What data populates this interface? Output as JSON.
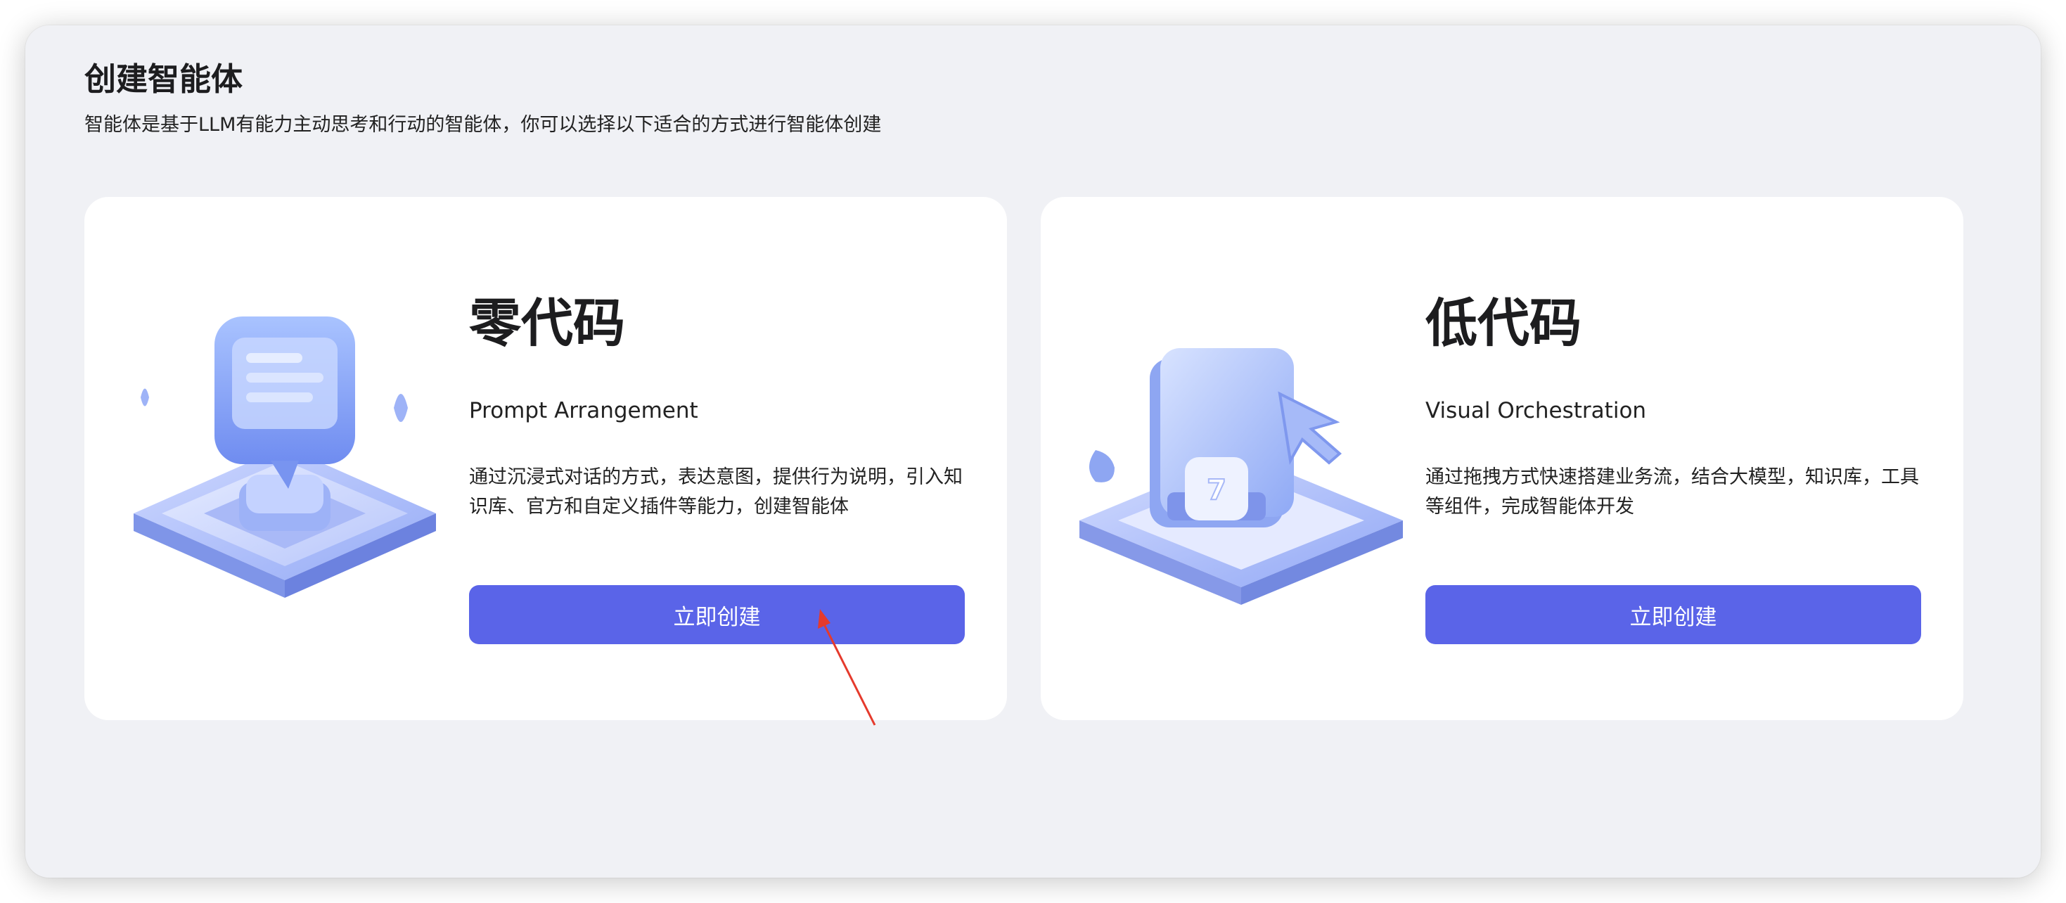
{
  "header": {
    "title": "创建智能体",
    "subtitle": "智能体是基于LLM有能力主动思考和行动的智能体，你可以选择以下适合的方式进行智能体创建"
  },
  "cards": [
    {
      "title": "零代码",
      "subtitle": "Prompt Arrangement",
      "description": "通过沉浸式对话的方式，表达意图，提供行为说明，引入知识库、官方和自定义插件等能力，创建智能体",
      "button_label": "立即创建",
      "icon": "chat-bubble-illustration"
    },
    {
      "title": "低代码",
      "subtitle": "Visual Orchestration",
      "description": "通过拖拽方式快速搭建业务流，结合大模型，知识库，工具等组件，完成智能体开发",
      "button_label": "立即创建",
      "icon": "drag-cursor-illustration"
    }
  ],
  "colors": {
    "background": "#f0f1f5",
    "card": "#ffffff",
    "primary_button": "#5a64e8",
    "annotation_arrow": "#e53a2c"
  }
}
